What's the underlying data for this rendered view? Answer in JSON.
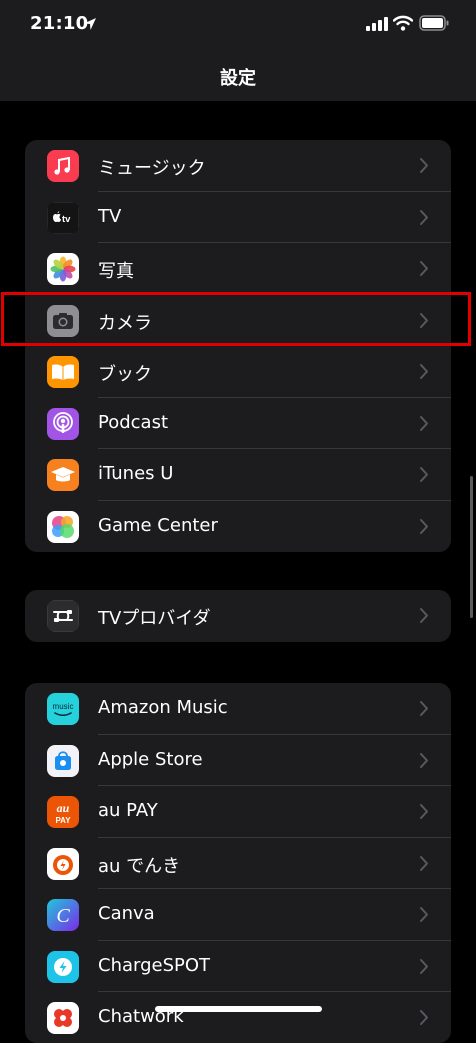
{
  "status_bar": {
    "time": "21:10",
    "icons": [
      "location-arrow-icon",
      "cellular-signal-icon",
      "wifi-icon",
      "battery-icon"
    ]
  },
  "nav": {
    "title": "設定"
  },
  "groups": [
    {
      "items": [
        {
          "label": "ミュージック",
          "icon": "music-icon"
        },
        {
          "label": "TV",
          "icon": "apple-tv-icon"
        },
        {
          "label": "写真",
          "icon": "photos-icon"
        },
        {
          "label": "カメラ",
          "icon": "camera-icon",
          "highlighted": true
        },
        {
          "label": "ブック",
          "icon": "books-icon"
        },
        {
          "label": "Podcast",
          "icon": "podcast-icon"
        },
        {
          "label": "iTunes U",
          "icon": "itunes-u-icon"
        },
        {
          "label": "Game Center",
          "icon": "game-center-icon"
        }
      ]
    },
    {
      "items": [
        {
          "label": "TVプロバイダ",
          "icon": "tv-provider-icon"
        }
      ]
    },
    {
      "items": [
        {
          "label": "Amazon Music",
          "icon": "amazon-music-icon"
        },
        {
          "label": "Apple Store",
          "icon": "apple-store-icon"
        },
        {
          "label": "au PAY",
          "icon": "au-pay-icon"
        },
        {
          "label": "au でんき",
          "icon": "au-denki-icon"
        },
        {
          "label": "Canva",
          "icon": "canva-icon"
        },
        {
          "label": "ChargeSPOT",
          "icon": "chargespot-icon"
        },
        {
          "label": "Chatwork",
          "icon": "chatwork-icon"
        }
      ]
    }
  ],
  "icon_text": {
    "tv": "tv",
    "amazon_music": "music",
    "au": "au",
    "au_pay": "PAY",
    "canva": "C"
  },
  "colors": {
    "background": "#000000",
    "group_background": "#1c1c1e",
    "highlight": "#e00000",
    "chevron": "#5a5a5e"
  }
}
